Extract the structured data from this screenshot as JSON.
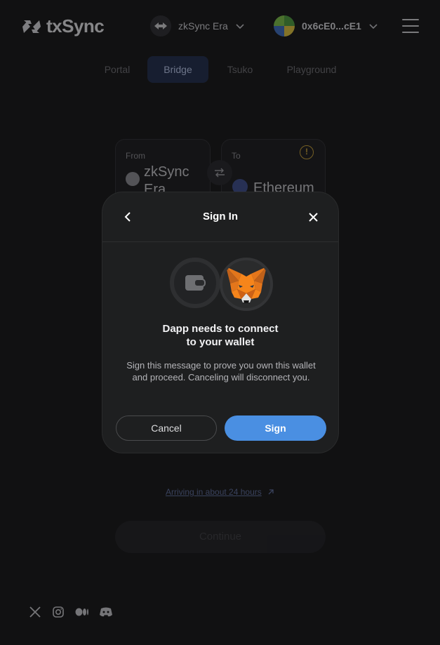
{
  "header": {
    "logo_text": "txSync",
    "network": {
      "name": "zkSync Era",
      "icon": "zksync-icon"
    },
    "account": {
      "address": "0x6cE0...cE1",
      "icon": "avatar"
    },
    "menu_icon": "hamburger-menu-icon"
  },
  "tabs": [
    {
      "label": "Portal",
      "active": false
    },
    {
      "label": "Bridge",
      "active": true
    },
    {
      "label": "Tsuko",
      "active": false
    },
    {
      "label": "Playground",
      "active": false
    }
  ],
  "bridge": {
    "from_label": "From",
    "from_chain": "zkSync Era",
    "to_label": "To",
    "to_chain": "Ethereum",
    "arrival_text": "Arriving in about 24 hours",
    "continue_label": "Continue"
  },
  "modal": {
    "title": "Sign In",
    "heading_line1": "Dapp needs to connect",
    "heading_line2": "to your wallet",
    "body": "Sign this message to prove you own this wallet and proceed. Canceling will disconnect you.",
    "cancel_label": "Cancel",
    "sign_label": "Sign"
  },
  "social": [
    "x-icon",
    "instagram-icon",
    "medium-icon",
    "discord-icon"
  ],
  "colors": {
    "background": "#111112",
    "modal": "#1e1f20",
    "primary": "#4a8fe2",
    "active_tab": "#1d2a4a"
  }
}
